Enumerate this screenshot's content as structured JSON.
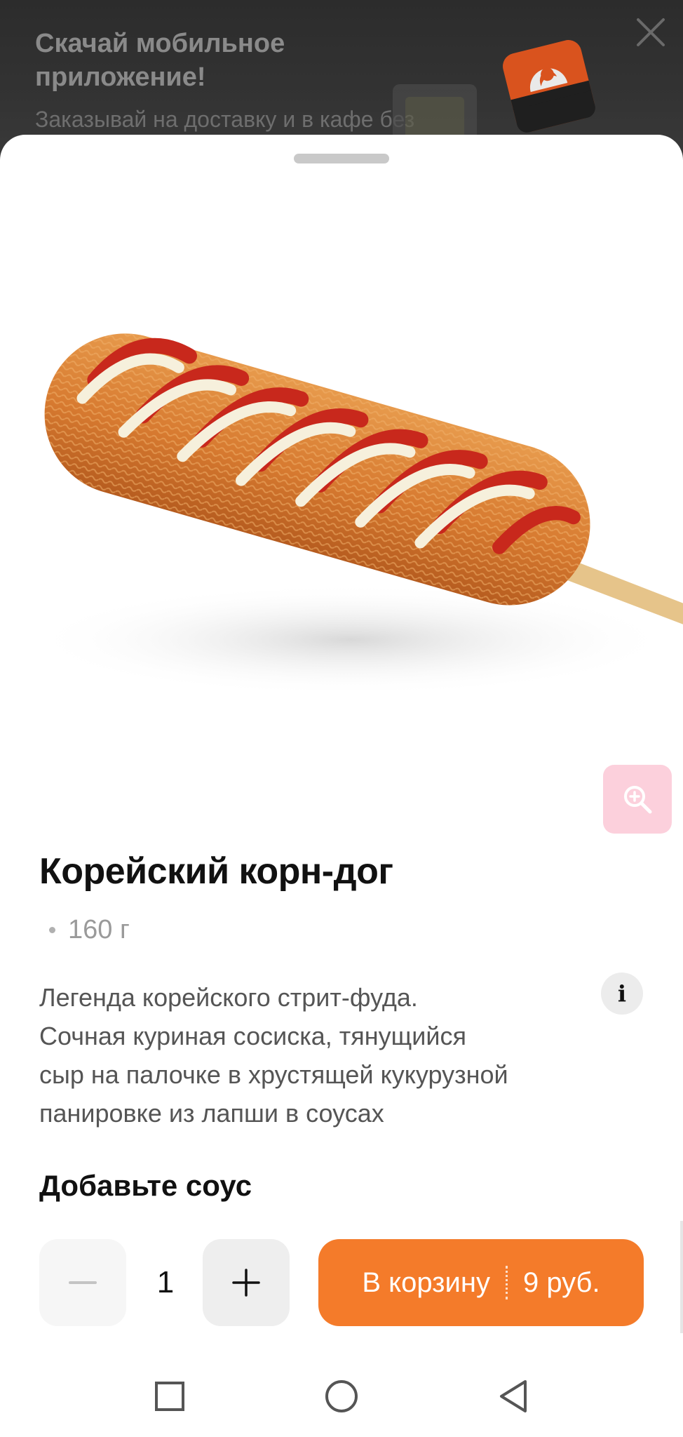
{
  "promo": {
    "title": "Скачай мобильное приложение!",
    "subtitle": "Заказывай на доставку и в кафе без",
    "icons": {
      "close": "close-icon",
      "logo": "app-logo-icon"
    }
  },
  "product": {
    "title": "Корейский корн-дог",
    "weight": "160 г",
    "description": [
      "Легенда корейского стрит-фуда.",
      "Сочная куриная сосиска, тянущийся",
      "сыр на палочке в хрустящей кукурузной",
      "панировке из лапши в соусах"
    ],
    "info_label": "i"
  },
  "sauce": {
    "heading": "Добавьте соус"
  },
  "order": {
    "quantity": "1",
    "cart_label": "В корзину",
    "price": "9 руб.",
    "accent_color": "#f47b2a"
  },
  "icons": {
    "zoom": "zoom-in-icon",
    "minus": "minus-icon",
    "plus": "plus-icon",
    "nav": [
      "square-recents-icon",
      "circle-home-icon",
      "triangle-back-icon"
    ]
  }
}
